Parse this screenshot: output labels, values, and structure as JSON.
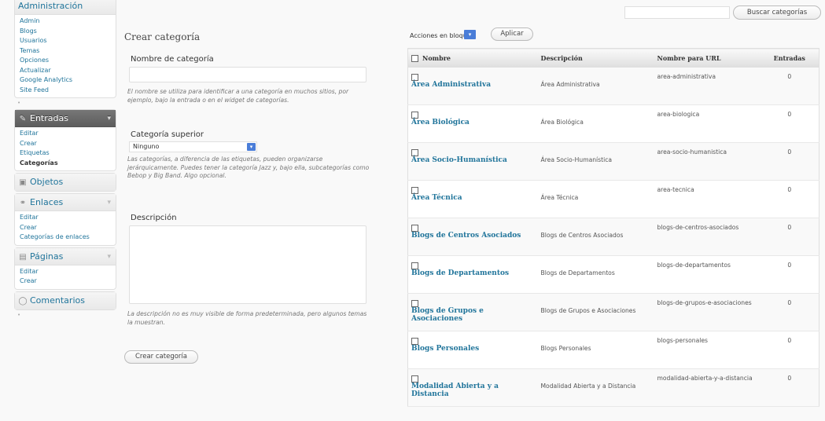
{
  "sidebar": {
    "admin_group": {
      "title": "Administración",
      "items": [
        "Admin",
        "Blogs",
        "Usuarios",
        "Temas",
        "Opciones",
        "Actualizar",
        "Google Analytics",
        "Site Feed"
      ]
    },
    "entradas_group": {
      "title": "Entradas",
      "items": [
        "Editar",
        "Crear",
        "Etiquetas",
        "Categorías"
      ]
    },
    "objetos": {
      "title": "Objetos"
    },
    "enlaces_group": {
      "title": "Enlaces",
      "items": [
        "Editar",
        "Crear",
        "Categorías de enlaces"
      ]
    },
    "paginas_group": {
      "title": "Páginas",
      "items": [
        "Editar",
        "Crear"
      ]
    },
    "comentarios": {
      "title": "Comentarios"
    }
  },
  "form": {
    "title": "Crear categoría",
    "name_label": "Nombre de categoría",
    "name_value": "",
    "name_hint": "El nombre se utiliza para identificar a una categoría en muchos sitios, por ejemplo, bajo la entrada o en el widget de categorías.",
    "parent_label": "Categoría superior",
    "parent_value": "Ninguno",
    "parent_hint": "Las categorías, a diferencia de las etiquetas, pueden organizarse jerárquicamente. Puedes tener la categoría Jazz y, bajo ella, subcategorías como Bebop y Big Band. Algo opcional.",
    "desc_label": "Descripción",
    "desc_value": "",
    "desc_hint": "La descripción no es muy visible de forma predeterminada, pero algunos temas la muestran.",
    "submit_label": "Crear categoría"
  },
  "list": {
    "search_button": "Buscar categorías",
    "bulk_label": "Acciones en bloque",
    "apply_button": "Aplicar",
    "columns": {
      "name": "Nombre",
      "desc": "Descripción",
      "slug": "Nombre para URL",
      "count": "Entradas"
    },
    "rows": [
      {
        "name": "Área Administrativa",
        "desc": "Área Administrativa",
        "slug": "area-administrativa",
        "count": "0"
      },
      {
        "name": "Área Biológica",
        "desc": "Área Biológica",
        "slug": "area-biologica",
        "count": "0"
      },
      {
        "name": "Área Socio-Humanística",
        "desc": "Área Socio-Humanística",
        "slug": "area-socio-humanistica",
        "count": "0"
      },
      {
        "name": "Área Técnica",
        "desc": "Área Técnica",
        "slug": "area-tecnica",
        "count": "0"
      },
      {
        "name": "Blogs de Centros Asociados",
        "desc": "Blogs de Centros Asociados",
        "slug": "blogs-de-centros-asociados",
        "count": "0"
      },
      {
        "name": "Blogs de Departamentos",
        "desc": "Blogs de Departamentos",
        "slug": "blogs-de-departamentos",
        "count": "0"
      },
      {
        "name": "Blogs de Grupos e Asociaciones",
        "desc": "Blogs de Grupos e Asociaciones",
        "slug": "blogs-de-grupos-e-asociaciones",
        "count": "0"
      },
      {
        "name": "Blogs Personales",
        "desc": "Blogs Personales",
        "slug": "blogs-personales",
        "count": "0"
      },
      {
        "name": "Modalidad Abierta y a Distancia",
        "desc": "Modalidad Abierta y a Distancia",
        "slug": "modalidad-abierta-y-a-distancia",
        "count": "0"
      }
    ]
  },
  "colors": {
    "link": "#21759b",
    "active_menu": "#5d5d5d",
    "border": "#dfdfdf"
  }
}
